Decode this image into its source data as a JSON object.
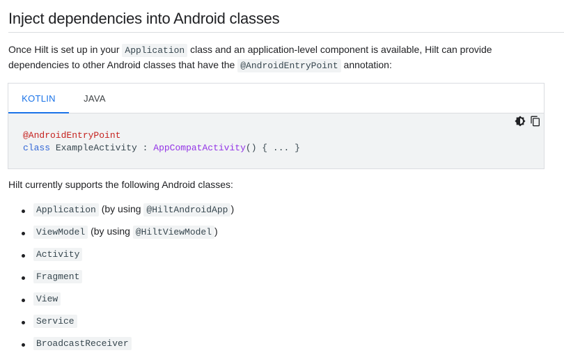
{
  "heading": "Inject dependencies into Android classes",
  "intro": {
    "t1": "Once Hilt is set up in your ",
    "code1": "Application",
    "t2": " class and an application-level component is available, Hilt can provide",
    "t3": "dependencies to other Android classes that have the ",
    "code2": "@AndroidEntryPoint",
    "t4": " annotation:"
  },
  "code_block": {
    "tabs": [
      "KOTLIN",
      "JAVA"
    ],
    "active_tab": "KOTLIN",
    "line1": "@AndroidEntryPoint",
    "line2_kw": "class",
    "line2_name": "ExampleActivity",
    "line2_sep": " : ",
    "line2_type": "AppCompatActivity",
    "line2_rest": "() { ... }"
  },
  "supports_text": "Hilt currently supports the following Android classes:",
  "classes": [
    {
      "code": "Application",
      "pre": " (by using ",
      "code2": "@HiltAndroidApp",
      "post": ")"
    },
    {
      "code": "ViewModel",
      "pre": " (by using ",
      "code2": "@HiltViewModel",
      "post": ")"
    },
    {
      "code": "Activity"
    },
    {
      "code": "Fragment"
    },
    {
      "code": "View"
    },
    {
      "code": "Service"
    },
    {
      "code": "BroadcastReceiver"
    }
  ],
  "icons": {
    "theme_toggle": "brightness-icon",
    "copy": "copy-icon"
  },
  "colors": {
    "accent": "#1a73e8",
    "code_bg": "#f1f3f4",
    "annotation": "#c5221f",
    "keyword": "#3367d6",
    "type": "#9334e6"
  }
}
